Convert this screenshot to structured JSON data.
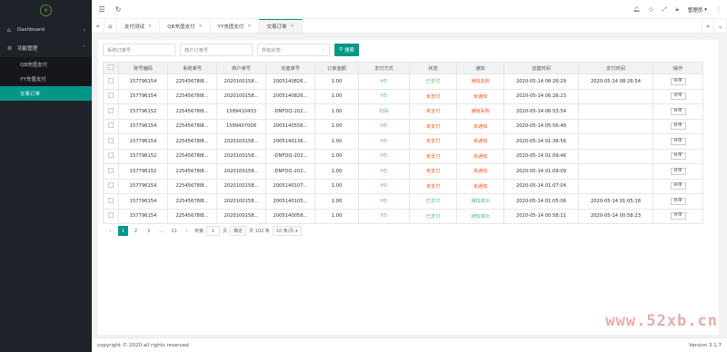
{
  "sidebar": {
    "items": [
      {
        "label": "Dashboard",
        "icon": "home-icon"
      },
      {
        "label": "功能管理",
        "icon": "gear-icon"
      }
    ],
    "sub_items": [
      "QB充值支付",
      "YY充值支付",
      "交易订单"
    ]
  },
  "header": {
    "user": "管理员"
  },
  "tabs": [
    {
      "label": "支付测试"
    },
    {
      "label": "QB充值支付"
    },
    {
      "label": "YY充值支付"
    },
    {
      "label": "交易订单"
    }
  ],
  "filters": {
    "sys_order_placeholder": "系统订单号",
    "merchant_order_placeholder": "商户订单号",
    "status_select": "所有状态",
    "search_label": "搜索"
  },
  "table": {
    "headers": [
      "账号编码",
      "系统单号",
      "商户单号",
      "充值单号",
      "订单金额",
      "支付方式",
      "状态",
      "通知",
      "创建时间",
      "支付时间",
      "操作"
    ],
    "rows": [
      [
        "157796154",
        "22545678l8...",
        "2020100158...",
        "2005140826...",
        "1.00",
        "H5",
        "已支付",
        "通知失败",
        "2020-05-14 08:26:29",
        "2020-05-14 08:26:54",
        "补单"
      ],
      [
        "157796154",
        "22545678l8...",
        "2020100158...",
        "2005140826...",
        "1.00",
        "H5",
        "未支付",
        "未通知",
        "2020-05-14 06:26:23",
        "",
        "补单"
      ],
      [
        "157796152",
        "22545678l8...",
        "1589410433",
        "-DNFDQ-202...",
        "1.00",
        "扫码",
        "未支付",
        "通知失败",
        "2020-05-14 06:53:54",
        "",
        "补单"
      ],
      [
        "157796154",
        "22545678l8...",
        "1589407008",
        "2005140556...",
        "1.00",
        "H5",
        "未支付",
        "未通知",
        "2020-05-14 05:56:48",
        "",
        "补单"
      ],
      [
        "157796154",
        "22545678l8...",
        "2020100158...",
        "2005140136...",
        "1.00",
        "H5",
        "未支付",
        "未通知",
        "2020-05-14 01:36:56",
        "",
        "补单"
      ],
      [
        "157796152",
        "22545678l8...",
        "2020100158...",
        "-DNFDQ-202...",
        "1.00",
        "H5",
        "未支付",
        "未通知",
        "2020-05-14 01:09:46",
        "",
        "补单"
      ],
      [
        "157796152",
        "22545678l8...",
        "2020100158...",
        "-DNFDQ-202...",
        "1.00",
        "H5",
        "未支付",
        "未通知",
        "2020-05-14 01:09:09",
        "",
        "补单"
      ],
      [
        "157796154",
        "22545678l8...",
        "2020100158...",
        "2005140107...",
        "1.00",
        "H5",
        "未支付",
        "未通知",
        "2020-05-14 01:07:04",
        "",
        "补单"
      ],
      [
        "157796154",
        "22545678l8...",
        "2020100158...",
        "2005140105...",
        "1.00",
        "H5",
        "已支付",
        "通知成功",
        "2020-05-14 01:05:06",
        "2020-05-14 01:05:18",
        "补单"
      ],
      [
        "157796154",
        "22545678l8...",
        "2020100158...",
        "2005140058...",
        "1.00",
        "H5",
        "已支付",
        "通知成功",
        "2020-05-14 00:58:11",
        "2020-05-14 00:58:23",
        "补单"
      ]
    ]
  },
  "pager": {
    "pages": [
      "1",
      "2",
      "3",
      "...",
      "11"
    ],
    "goto_label": "到第",
    "goto_value": "1",
    "page_unit": "页",
    "confirm": "确定",
    "total": "共 102 条",
    "per_page": "10 条/页"
  },
  "footer": {
    "copyright": "copyright © 2020 all rights reserved.",
    "version": "Version 3.1.7"
  },
  "watermark": "www.52xb.cn",
  "colors": {
    "accent": "#009688",
    "success": "#5fb878",
    "danger": "#ff5722",
    "sidebar": "#20222a"
  }
}
